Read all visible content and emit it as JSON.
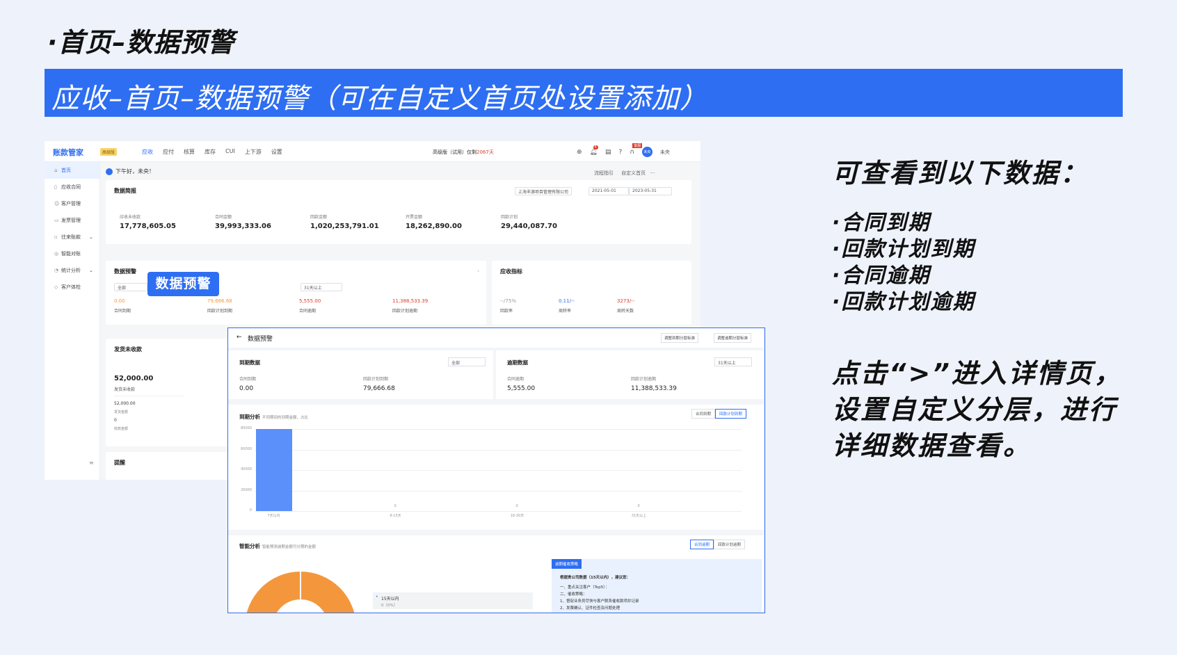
{
  "slide": {
    "title": "·首页–数据预警",
    "banner": "应收–首页–数据预警（可在自定义首页处设置添加）",
    "notes_heading": "可查看到以下数据：",
    "notes_items": [
      "·合同到期",
      "·回款计划到期",
      "·合同逾期",
      "·回款计划逾期"
    ],
    "notes_paragraph": "点击“>”进入详情页，设置自定义分层，进行详细数据查看。",
    "callout": "数据预警"
  },
  "app": {
    "logo": "账款管家",
    "logo_badge": "高级版",
    "nav": [
      "应收",
      "应付",
      "核算",
      "库存",
      "CUI",
      "上下游",
      "设置"
    ],
    "version_text": "高级版（试用）仅剩",
    "version_days": "2067天",
    "bell_count": "4",
    "user_badge": "客服",
    "avatar_text": "未央",
    "user_name": "未央",
    "sidebar": [
      "首页",
      "应收合同",
      "客户管理",
      "发票管理",
      "往来账款",
      "智能对账",
      "统计分析",
      "客户体检"
    ],
    "greeting": "下午好，未央！",
    "guide": "流程指引",
    "customize": "自定义首页",
    "briefing": {
      "title": "数据简报",
      "company": "上海丰源项目管理有限公司",
      "date_from": "2021-05-01",
      "date_to": "2023-05-31",
      "stats": [
        {
          "label": "应收未收款",
          "value": "17,778,605.05"
        },
        {
          "label": "合同金额",
          "value": "39,993,333.06"
        },
        {
          "label": "回款金额",
          "value": "1,020,253,791.01"
        },
        {
          "label": "开票金额",
          "value": "18,262,890.00"
        },
        {
          "label": "回款计划",
          "value": "29,440,087.70"
        }
      ]
    },
    "warning": {
      "title": "数据预警",
      "filter_all": "全部",
      "filter_days": "31天以上",
      "items": [
        {
          "value": "0.00",
          "label": "合同到期",
          "color": "#f4973c"
        },
        {
          "value": "79,666.68",
          "label": "回款计划到期",
          "color": "#f4973c"
        },
        {
          "value": "5,555.00",
          "label": "合同逾期",
          "color": "#e0392b"
        },
        {
          "value": "11,388,533.39",
          "label": "回款计划逾期",
          "color": "#e0392b"
        }
      ]
    },
    "indicators": {
      "title": "应收指标",
      "items": [
        {
          "value": "--/75%",
          "label": "回款率",
          "color": "#999999"
        },
        {
          "value": "0.11/--",
          "label": "周转率",
          "color": "#2e6ef2"
        },
        {
          "value": "3273/--",
          "label": "周转天数",
          "color": "#e0392b"
        }
      ]
    },
    "shipping": {
      "title": "发货未收款",
      "value": "52,000.00",
      "value_label": "发货未收款",
      "sub1_value": "52,000.00",
      "sub1_label": "发货金额",
      "sub2_value": "0",
      "sub2_label": "收款金额"
    },
    "reminder": {
      "title": "提醒"
    }
  },
  "detail": {
    "back": "←",
    "title": "数据预警",
    "btn_due": "调整到期分层标准",
    "btn_overdue": "调整逾期分层标准",
    "due": {
      "title": "到期数据",
      "select": "全部",
      "items": [
        {
          "label": "合同到期",
          "value": "0.00"
        },
        {
          "label": "回款计划到期",
          "value": "79,666.68"
        }
      ]
    },
    "overdue": {
      "title": "逾期数据",
      "select": "31天以上",
      "items": [
        {
          "label": "合同逾期",
          "value": "5,555.00"
        },
        {
          "label": "回款计划逾期",
          "value": "11,388,533.39"
        }
      ]
    },
    "analysis": {
      "title": "到期分析",
      "subtitle": "不同期间的到期金额、占比",
      "tabs": [
        "合同到期",
        "回款计划到期"
      ],
      "active_tab": 1
    },
    "smart": {
      "title": "智能分析",
      "subtitle": "智能预测逾期金额可分期的金额",
      "tabs": [
        "合同逾期",
        "回款计划逾期"
      ],
      "active_tab": 0,
      "legend_label": "15天以内",
      "legend_value": "0（0%）",
      "suggest_tag": "逾期催收策略",
      "suggest_lines": [
        "根据贵公司数据（15天以内），建议您：",
        "一、重点关注客户（Top5）：",
        "二、催收策略：",
        "1、督促业务员尽快与客户联系催收款项并记录",
        "2、发票确认、证件检查及问题处理"
      ]
    }
  },
  "chart_data": {
    "type": "bar",
    "categories": [
      "7天以内",
      "8-15天",
      "16-30天",
      "31天以上"
    ],
    "values": [
      79666.68,
      0,
      0,
      0
    ],
    "ylim": [
      0,
      80000
    ],
    "yticks": [
      0,
      20000,
      40000,
      60000,
      80000
    ],
    "color": "#5b8ff9",
    "grid": true
  }
}
